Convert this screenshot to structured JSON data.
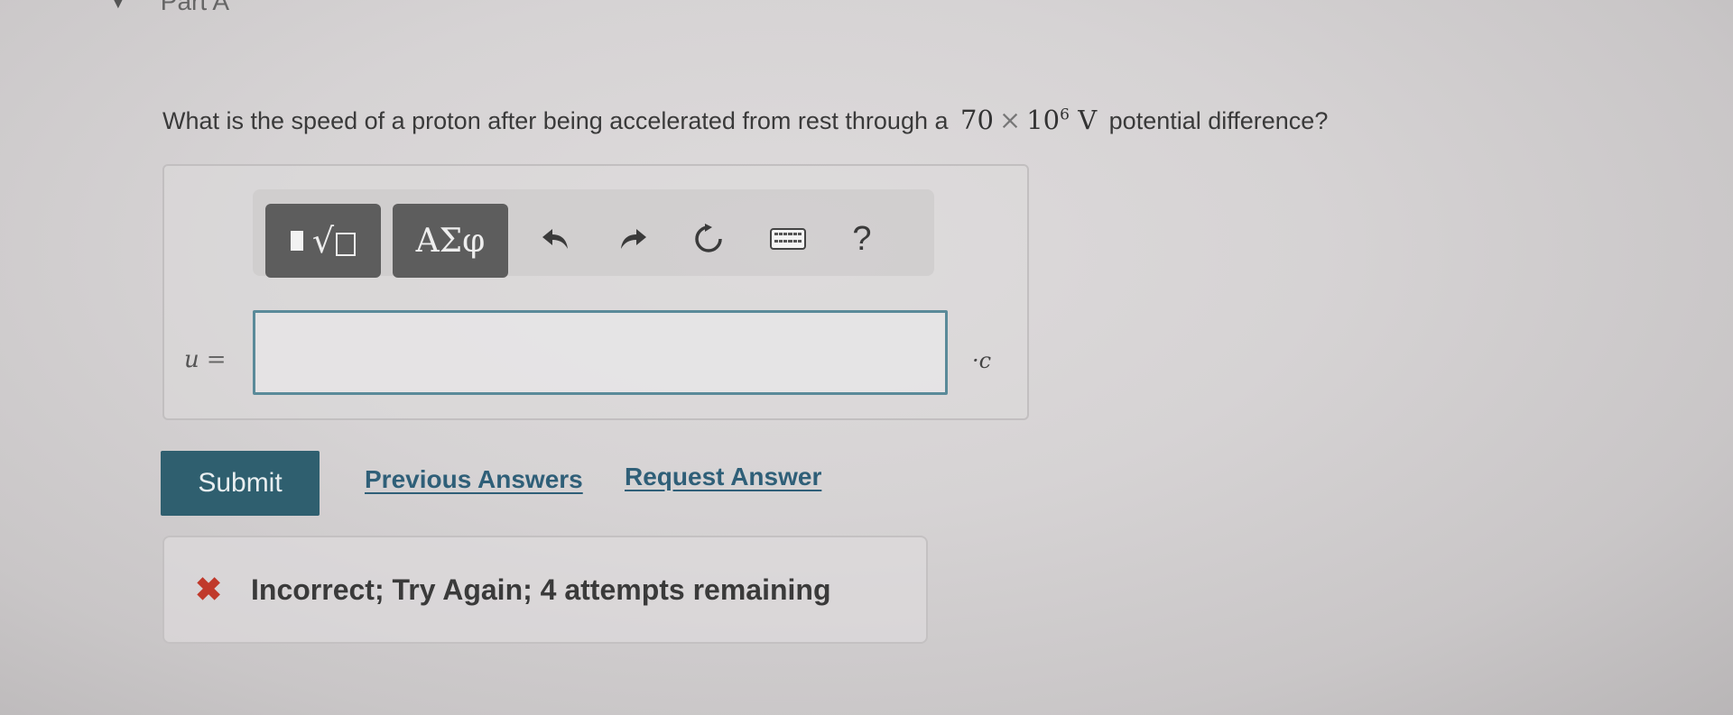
{
  "header": {
    "part_label": "Part A"
  },
  "question": {
    "text_before": "What is the speed of a proton after being accelerated from rest through a",
    "coefficient": "70",
    "times_symbol": "×",
    "base": "10",
    "exponent": "6",
    "unit_symbol": "V",
    "text_after": "potential difference?"
  },
  "toolbar": {
    "greek_label": "ΑΣφ",
    "help_label": "?",
    "icons": [
      "templates-icon",
      "undo-icon",
      "redo-icon",
      "reset-icon",
      "keyboard-icon",
      "help-icon"
    ]
  },
  "answer": {
    "variable": "u",
    "equals": "=",
    "value": "",
    "unit": "·c"
  },
  "actions": {
    "submit_label": "Submit",
    "previous_answers_label": "Previous Answers",
    "request_answer_label": "Request Answer"
  },
  "feedback": {
    "icon": "x-icon",
    "message": "Incorrect; Try Again; 4 attempts remaining"
  },
  "colors": {
    "submit_bg": "#2f5f6f",
    "link": "#2f5f78",
    "error": "#c0392b",
    "input_border": "#5a8a99",
    "toolbar_dark": "#5d5d5d"
  }
}
